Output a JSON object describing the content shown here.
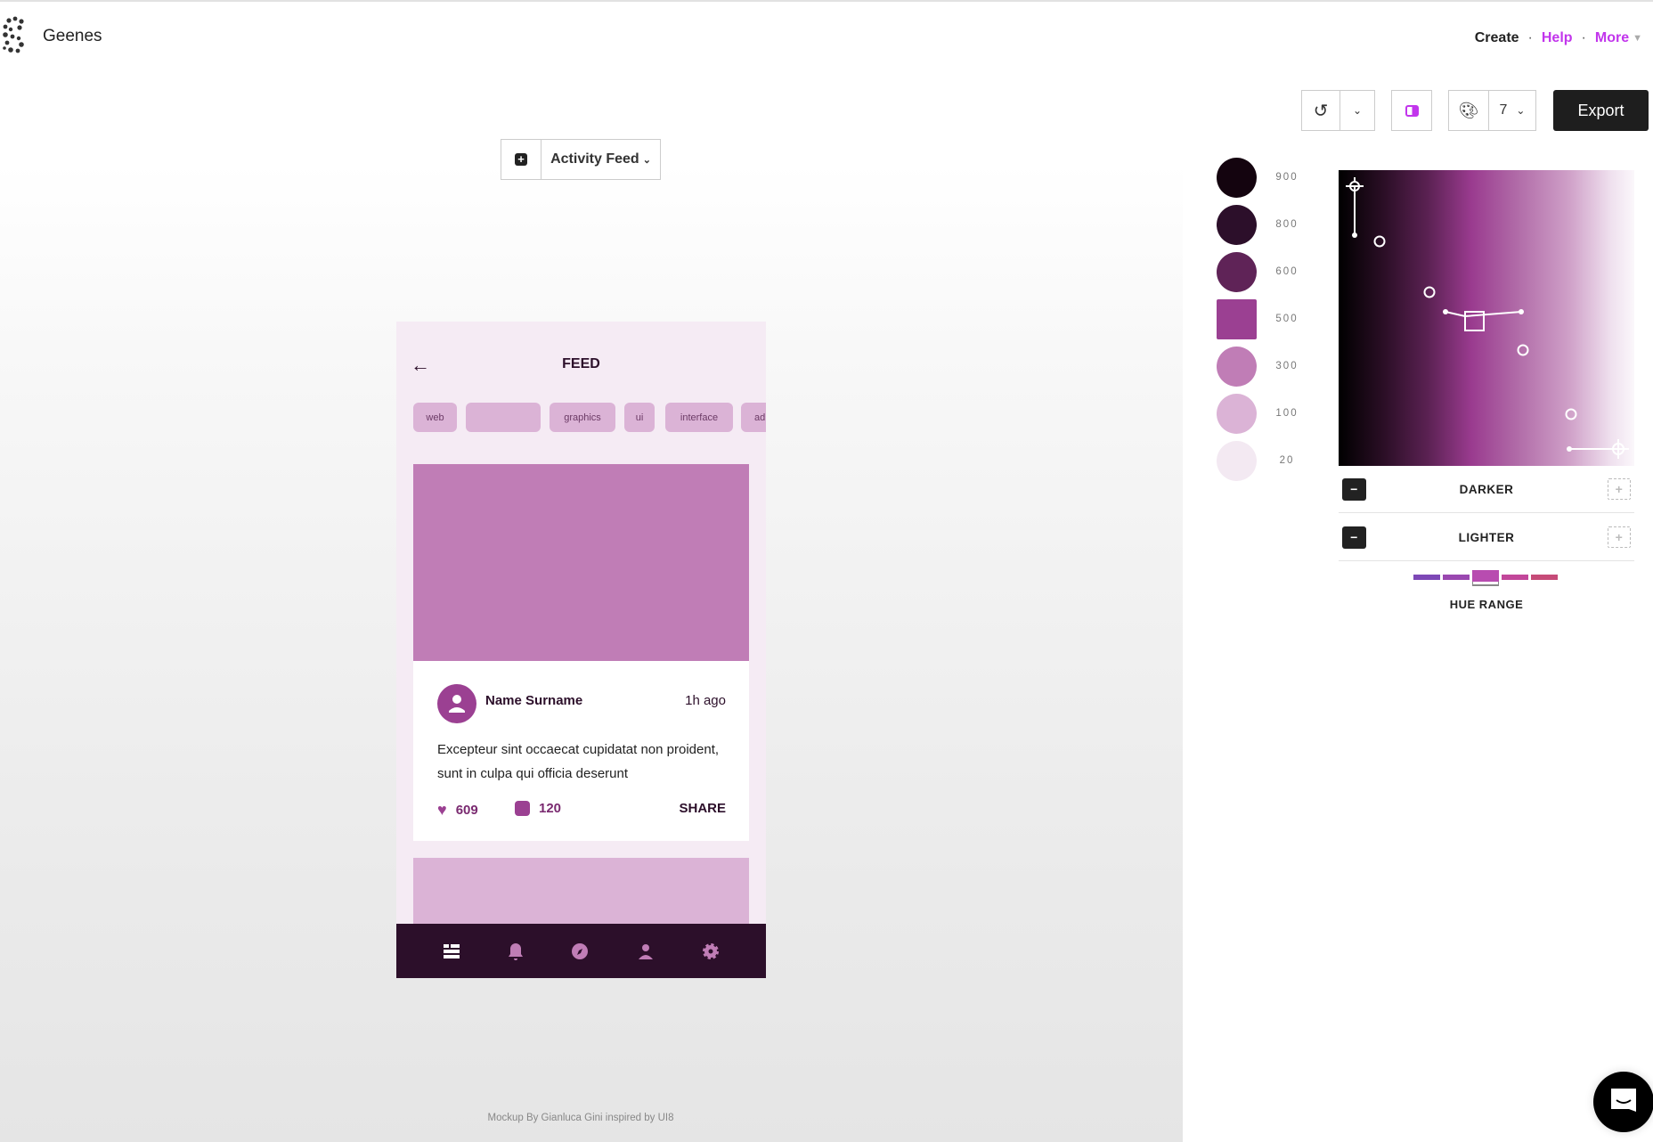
{
  "app": {
    "name": "Geenes"
  },
  "topnav": {
    "create": "Create",
    "help": "Help",
    "more": "More",
    "separator": "·"
  },
  "screen_selector": {
    "add_icon": "plus-square-icon",
    "selected": "Activity Feed"
  },
  "phone": {
    "title": "FEED",
    "chips": [
      "web",
      "",
      "graphics",
      "ui",
      "interface",
      "ad"
    ],
    "post": {
      "name": "Name Surname",
      "time": "1h ago",
      "text": "Excepteur sint occaecat cupidatat non proident, sunt in culpa qui officia deserunt",
      "likes": "609",
      "comments": "120",
      "share": "SHARE"
    },
    "nav_icons": [
      "feed-icon",
      "bell-icon",
      "compass-icon",
      "user-icon",
      "gear-icon"
    ]
  },
  "footer": "Mockup By Gianluca Gini inspired by UI8",
  "toolbar": {
    "shade_count": "7",
    "export": "Export"
  },
  "swatches": [
    {
      "label": "900",
      "color": "#14040f"
    },
    {
      "label": "800",
      "color": "#2c0f2a"
    },
    {
      "label": "600",
      "color": "#5f2357"
    },
    {
      "label": "500",
      "color": "#9b4092"
    },
    {
      "label": "300",
      "color": "#c07db6"
    },
    {
      "label": "100",
      "color": "#dbb3d6"
    },
    {
      "label": "20",
      "color": "#f3e9f2"
    }
  ],
  "editor": {
    "darker": "DARKER",
    "lighter": "LIGHTER",
    "hue_range": "HUE RANGE",
    "minus": "−",
    "plus": "+"
  },
  "hue_options": [
    "#7d48b6",
    "#9a48b0",
    "#b84cb0",
    "#c2479a",
    "#c64b78"
  ],
  "hue_selected_index": 2,
  "colors": {
    "accent": "#c235ec",
    "primary": "#9b4092",
    "dark": "#2c0f2a"
  }
}
